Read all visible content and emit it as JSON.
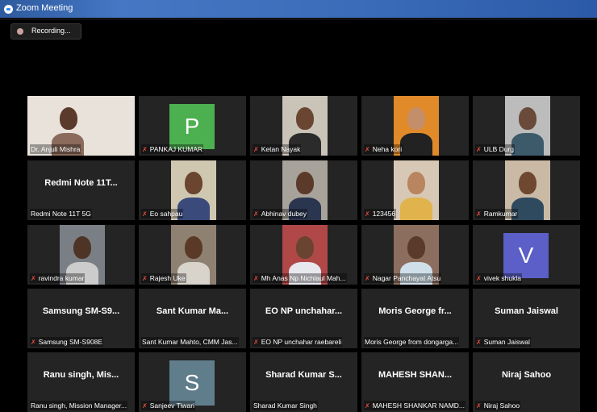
{
  "window": {
    "title": "Zoom Meeting"
  },
  "recording": {
    "label": "Recording..."
  },
  "participants": [
    {
      "name": "Dr. Anjuli Mishra",
      "muted": false,
      "type": "video"
    },
    {
      "name": "PANKAJ KUMAR",
      "muted": true,
      "type": "avatar",
      "initial": "P",
      "color": "#4caf50"
    },
    {
      "name": "Ketan Nayak",
      "muted": true,
      "type": "video"
    },
    {
      "name": "Neha kori",
      "muted": true,
      "type": "video"
    },
    {
      "name": "ULB Durg",
      "muted": true,
      "type": "video"
    },
    {
      "name": "Redmi Note 11T 5G",
      "muted": false,
      "type": "text",
      "display": "Redmi Note 11T..."
    },
    {
      "name": "Eo sahpau",
      "muted": true,
      "type": "video"
    },
    {
      "name": "Abhinav dubey",
      "muted": true,
      "type": "video"
    },
    {
      "name": "123456",
      "muted": true,
      "type": "video"
    },
    {
      "name": "Ramkumar",
      "muted": true,
      "type": "video"
    },
    {
      "name": "ravindra kumar",
      "muted": true,
      "type": "video"
    },
    {
      "name": "Rajesh Uke",
      "muted": true,
      "type": "video"
    },
    {
      "name": "Mh Anas Np Nichlaul Mah...",
      "muted": true,
      "type": "video"
    },
    {
      "name": "Nagar Panchayat Atsu",
      "muted": true,
      "type": "video"
    },
    {
      "name": "vivek shukla",
      "muted": true,
      "type": "avatar",
      "initial": "V",
      "color": "#5b5fc7"
    },
    {
      "name": "Samsung SM-S908E",
      "muted": true,
      "type": "text",
      "display": "Samsung SM-S9..."
    },
    {
      "name": "Sant Kumar Mahto, CMM Jas...",
      "muted": false,
      "type": "text",
      "display": "Sant Kumar Ma..."
    },
    {
      "name": "EO NP unchahar raebareli",
      "muted": true,
      "type": "text",
      "display": "EO NP unchahar..."
    },
    {
      "name": "Moris George from dongarga...",
      "muted": false,
      "type": "text",
      "display": "Moris George fr..."
    },
    {
      "name": "Suman Jaiswal",
      "muted": true,
      "type": "text",
      "display": "Suman Jaiswal"
    },
    {
      "name": "Ranu singh, Mission Manager...",
      "muted": false,
      "type": "text",
      "display": "Ranu singh, Mis..."
    },
    {
      "name": "Sanjeev Tiwari",
      "muted": true,
      "type": "avatar",
      "initial": "S",
      "color": "#607d8b"
    },
    {
      "name": "Sharad Kumar Singh",
      "muted": false,
      "type": "text",
      "display": "Sharad Kumar S..."
    },
    {
      "name": "MAHESH SHANKAR NAMD...",
      "muted": true,
      "type": "text",
      "display": "MAHESH  SHAN..."
    },
    {
      "name": "Niraj Sahoo",
      "muted": true,
      "type": "text",
      "display": "Niraj Sahoo"
    }
  ],
  "colors": {
    "accent": "#2d8cff",
    "tile": "#242424",
    "muted": "#e74c3c"
  }
}
